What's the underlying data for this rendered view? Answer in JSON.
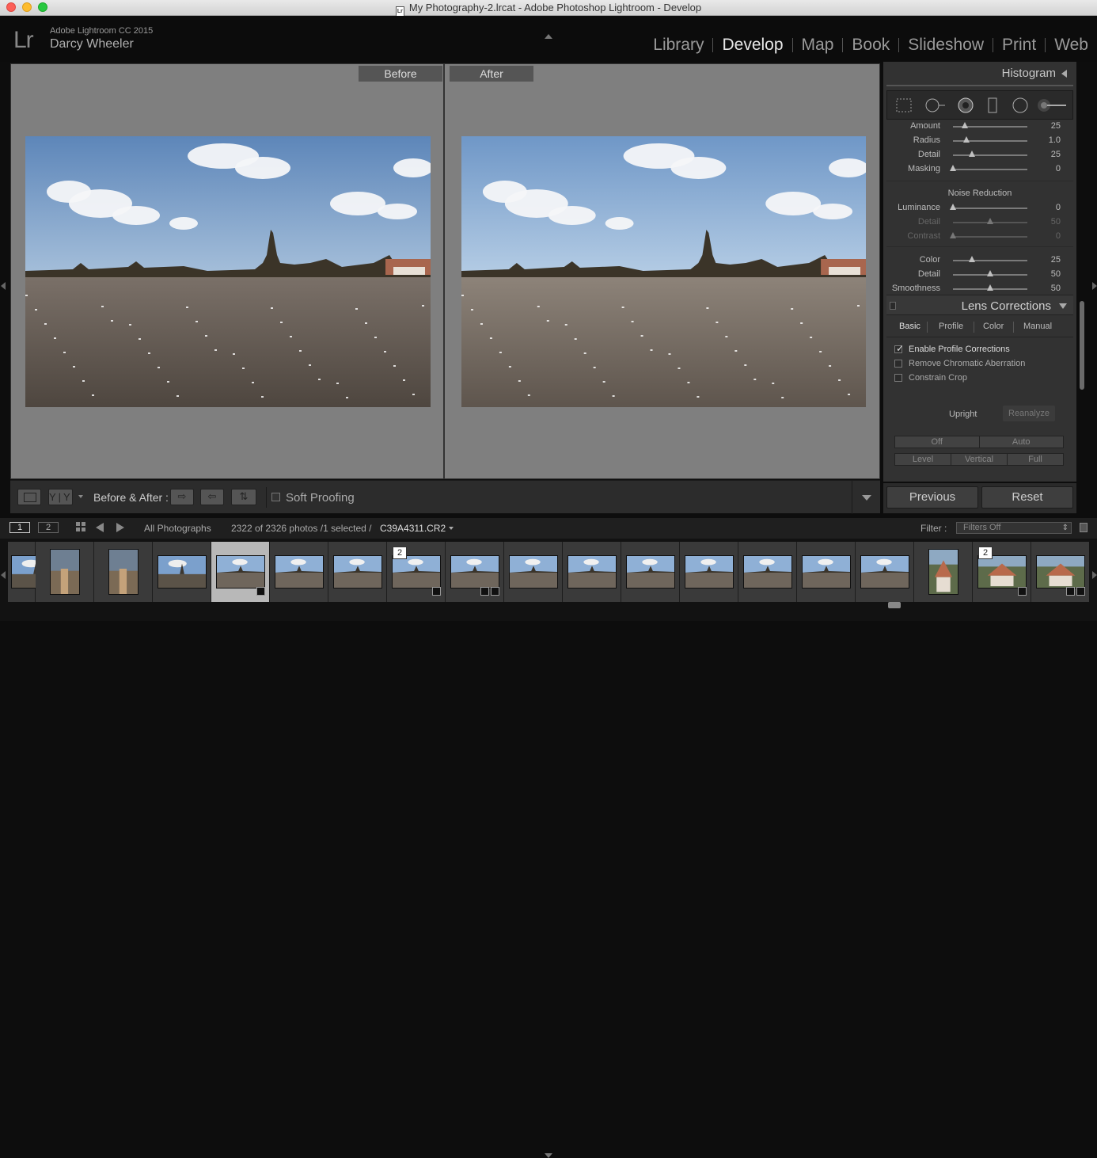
{
  "window": {
    "title": "My Photography-2.lrcat - Adobe Photoshop Lightroom - Develop",
    "doc_icon": "Lr"
  },
  "header": {
    "logo": "Lr",
    "app_version": "Adobe Lightroom CC 2015",
    "user": "Darcy Wheeler",
    "modules": [
      {
        "label": "Library",
        "active": false
      },
      {
        "label": "Develop",
        "active": true
      },
      {
        "label": "Map",
        "active": false
      },
      {
        "label": "Book",
        "active": false
      },
      {
        "label": "Slideshow",
        "active": false
      },
      {
        "label": "Print",
        "active": false
      },
      {
        "label": "Web",
        "active": false
      }
    ]
  },
  "viewer": {
    "before_label": "Before",
    "after_label": "After"
  },
  "toolbar": {
    "yy_label": "Y|Y",
    "before_after_label": "Before & After :",
    "soft_proofing_label": "Soft Proofing",
    "soft_proofing_checked": false
  },
  "right_panel": {
    "histogram_title": "Histogram",
    "tools": [
      "crop-overlay-icon",
      "spot-removal-icon",
      "red-eye-icon",
      "graduated-filter-icon",
      "radial-filter-icon",
      "adjustment-brush-icon"
    ],
    "sharpening": [
      {
        "label": "Amount",
        "value": "25",
        "pos": 0.16
      },
      {
        "label": "Radius",
        "value": "1.0",
        "pos": 0.18
      },
      {
        "label": "Detail",
        "value": "25",
        "pos": 0.25
      },
      {
        "label": "Masking",
        "value": "0",
        "pos": 0.0
      }
    ],
    "noise_reduction_title": "Noise Reduction",
    "luminance": [
      {
        "label": "Luminance",
        "value": "0",
        "pos": 0.0,
        "dim": false
      },
      {
        "label": "Detail",
        "value": "50",
        "pos": 0.5,
        "dim": true
      },
      {
        "label": "Contrast",
        "value": "0",
        "pos": 0.0,
        "dim": true
      }
    ],
    "color": [
      {
        "label": "Color",
        "value": "25",
        "pos": 0.25,
        "dim": false
      },
      {
        "label": "Detail",
        "value": "50",
        "pos": 0.5,
        "dim": false
      },
      {
        "label": "Smoothness",
        "value": "50",
        "pos": 0.5,
        "dim": false
      }
    ],
    "lens_corrections_title": "Lens Corrections",
    "lens_tabs": [
      {
        "label": "Basic",
        "active": true
      },
      {
        "label": "Profile",
        "active": false
      },
      {
        "label": "Color",
        "active": false
      },
      {
        "label": "Manual",
        "active": false
      }
    ],
    "checks": [
      {
        "label": "Enable Profile Corrections",
        "checked": true
      },
      {
        "label": "Remove Chromatic Aberration",
        "checked": false
      },
      {
        "label": "Constrain Crop",
        "checked": false
      }
    ],
    "upright_label": "Upright",
    "reanalyze_label": "Reanalyze",
    "upright_row1": [
      "Off",
      "Auto"
    ],
    "upright_row2": [
      "Level",
      "Vertical",
      "Full"
    ],
    "previous_label": "Previous",
    "reset_label": "Reset"
  },
  "filmstrip_bar": {
    "screen1": "1",
    "screen2": "2",
    "source": "All Photographs",
    "count": "2322 of 2326 photos /1 selected /",
    "filename": "C39A4311.CR2",
    "filter_label": "Filter :",
    "filter_value": "Filters Off"
  },
  "filmstrip": [
    {
      "kind": "temple-sky",
      "portrait": false,
      "stack": "",
      "badge": false,
      "badge2": false
    },
    {
      "kind": "people",
      "portrait": true,
      "stack": "",
      "badge": false,
      "badge2": false
    },
    {
      "kind": "people",
      "portrait": true,
      "stack": "",
      "badge": false,
      "badge2": false
    },
    {
      "kind": "temple-sky",
      "portrait": false,
      "stack": "",
      "badge": false,
      "badge2": false
    },
    {
      "kind": "river",
      "portrait": false,
      "stack": "",
      "badge": true,
      "badge2": false,
      "active": true
    },
    {
      "kind": "river",
      "portrait": false,
      "stack": "",
      "badge": false,
      "badge2": false
    },
    {
      "kind": "river",
      "portrait": false,
      "stack": "",
      "badge": false,
      "badge2": false
    },
    {
      "kind": "river",
      "portrait": false,
      "stack": "2",
      "badge": true,
      "badge2": false
    },
    {
      "kind": "river",
      "portrait": false,
      "stack": "",
      "badge": true,
      "badge2": true
    },
    {
      "kind": "river",
      "portrait": false,
      "stack": "",
      "badge": false,
      "badge2": false
    },
    {
      "kind": "river",
      "portrait": false,
      "stack": "",
      "badge": false,
      "badge2": false
    },
    {
      "kind": "river",
      "portrait": false,
      "stack": "",
      "badge": false,
      "badge2": false
    },
    {
      "kind": "river",
      "portrait": false,
      "stack": "",
      "badge": false,
      "badge2": false
    },
    {
      "kind": "river",
      "portrait": false,
      "stack": "",
      "badge": false,
      "badge2": false
    },
    {
      "kind": "river",
      "portrait": false,
      "stack": "",
      "badge": false,
      "badge2": false
    },
    {
      "kind": "river",
      "portrait": false,
      "stack": "",
      "badge": false,
      "badge2": false
    },
    {
      "kind": "house",
      "portrait": true,
      "stack": "",
      "badge": false,
      "badge2": false
    },
    {
      "kind": "house",
      "portrait": false,
      "stack": "2",
      "badge": true,
      "badge2": false
    },
    {
      "kind": "house",
      "portrait": false,
      "stack": "",
      "badge": true,
      "badge2": true
    }
  ]
}
